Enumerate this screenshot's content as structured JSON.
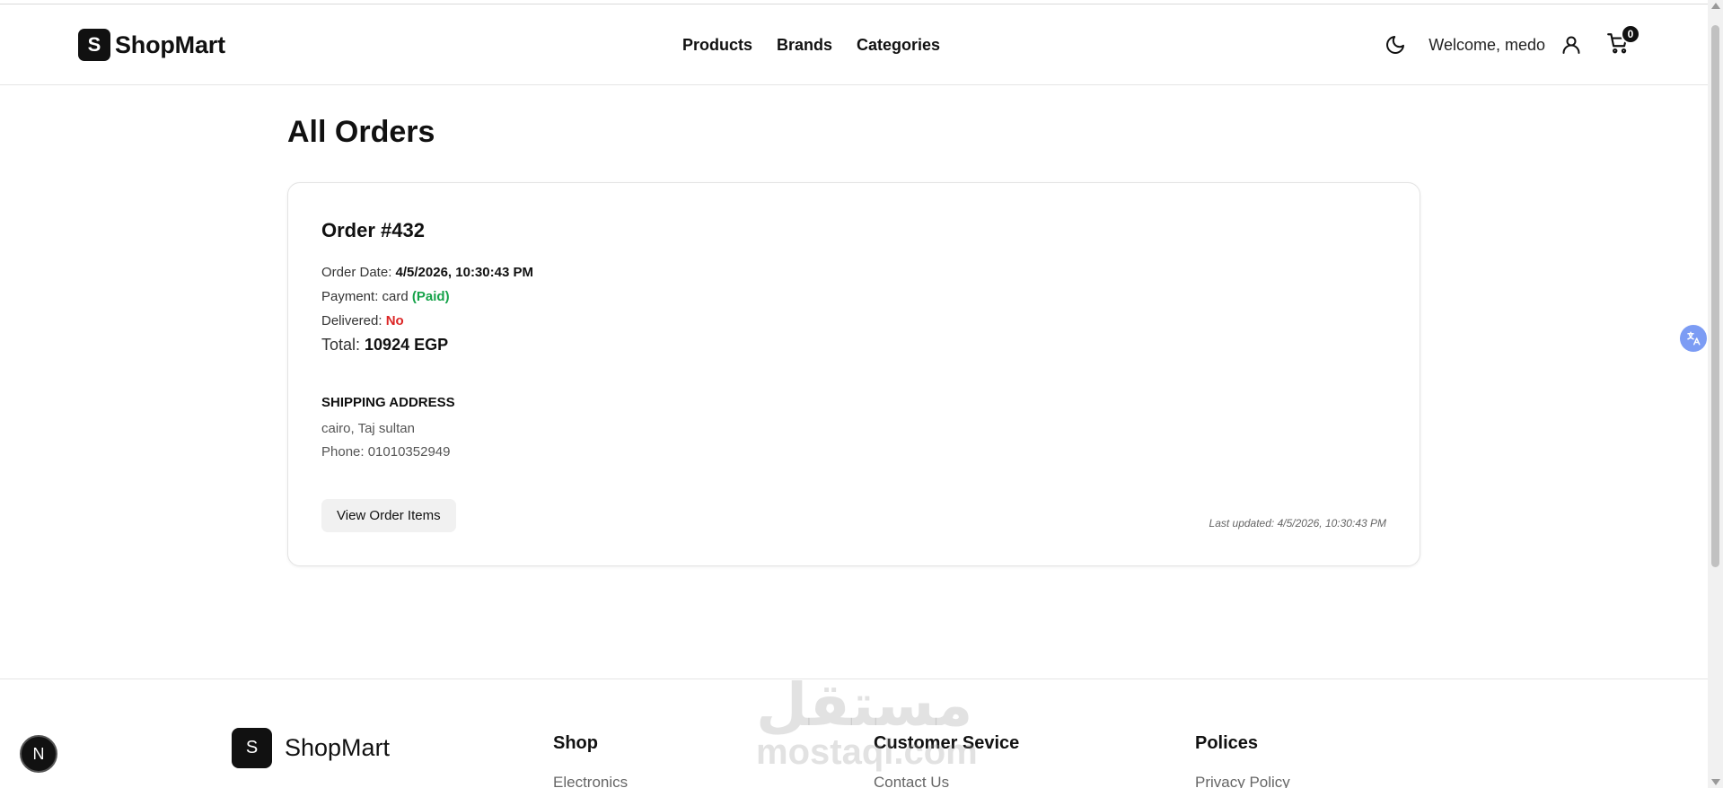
{
  "header": {
    "brand_mark": "S",
    "brand_name": "ShopMart",
    "nav": [
      "Products",
      "Brands",
      "Categories"
    ],
    "welcome": "Welcome, medo",
    "cart_count": "0"
  },
  "main": {
    "title": "All Orders",
    "order": {
      "title": "Order #432",
      "date_label": "Order Date: ",
      "date_value": "4/5/2026, 10:30:43 PM",
      "payment_label": "Payment: card ",
      "payment_status": "(Paid)",
      "delivered_label": "Delivered: ",
      "delivered_value": "No",
      "total_label": "Total: ",
      "total_value": "10924 EGP",
      "shipping_heading": "SHIPPING ADDRESS",
      "address": "cairo, Taj sultan",
      "phone": "Phone: 01010352949",
      "view_button": "View Order Items",
      "last_updated": "Last updated: 4/5/2026, 10:30:43 PM"
    }
  },
  "floating": {
    "translate_icon": "translate-icon",
    "next_badge": "N"
  },
  "footer": {
    "brand_mark": "S",
    "brand_name": "ShopMart",
    "columns": [
      {
        "heading": "Shop",
        "first_link": "Electronics"
      },
      {
        "heading": "Customer Sevice",
        "first_link": "Contact Us"
      },
      {
        "heading": "Polices",
        "first_link": "Privacy Policy"
      }
    ],
    "watermark_ar": "مستقل",
    "watermark_en": "mostaql.com"
  },
  "colors": {
    "paid": "#16a34a",
    "not_delivered": "#dc2626",
    "brand": "#111111"
  }
}
